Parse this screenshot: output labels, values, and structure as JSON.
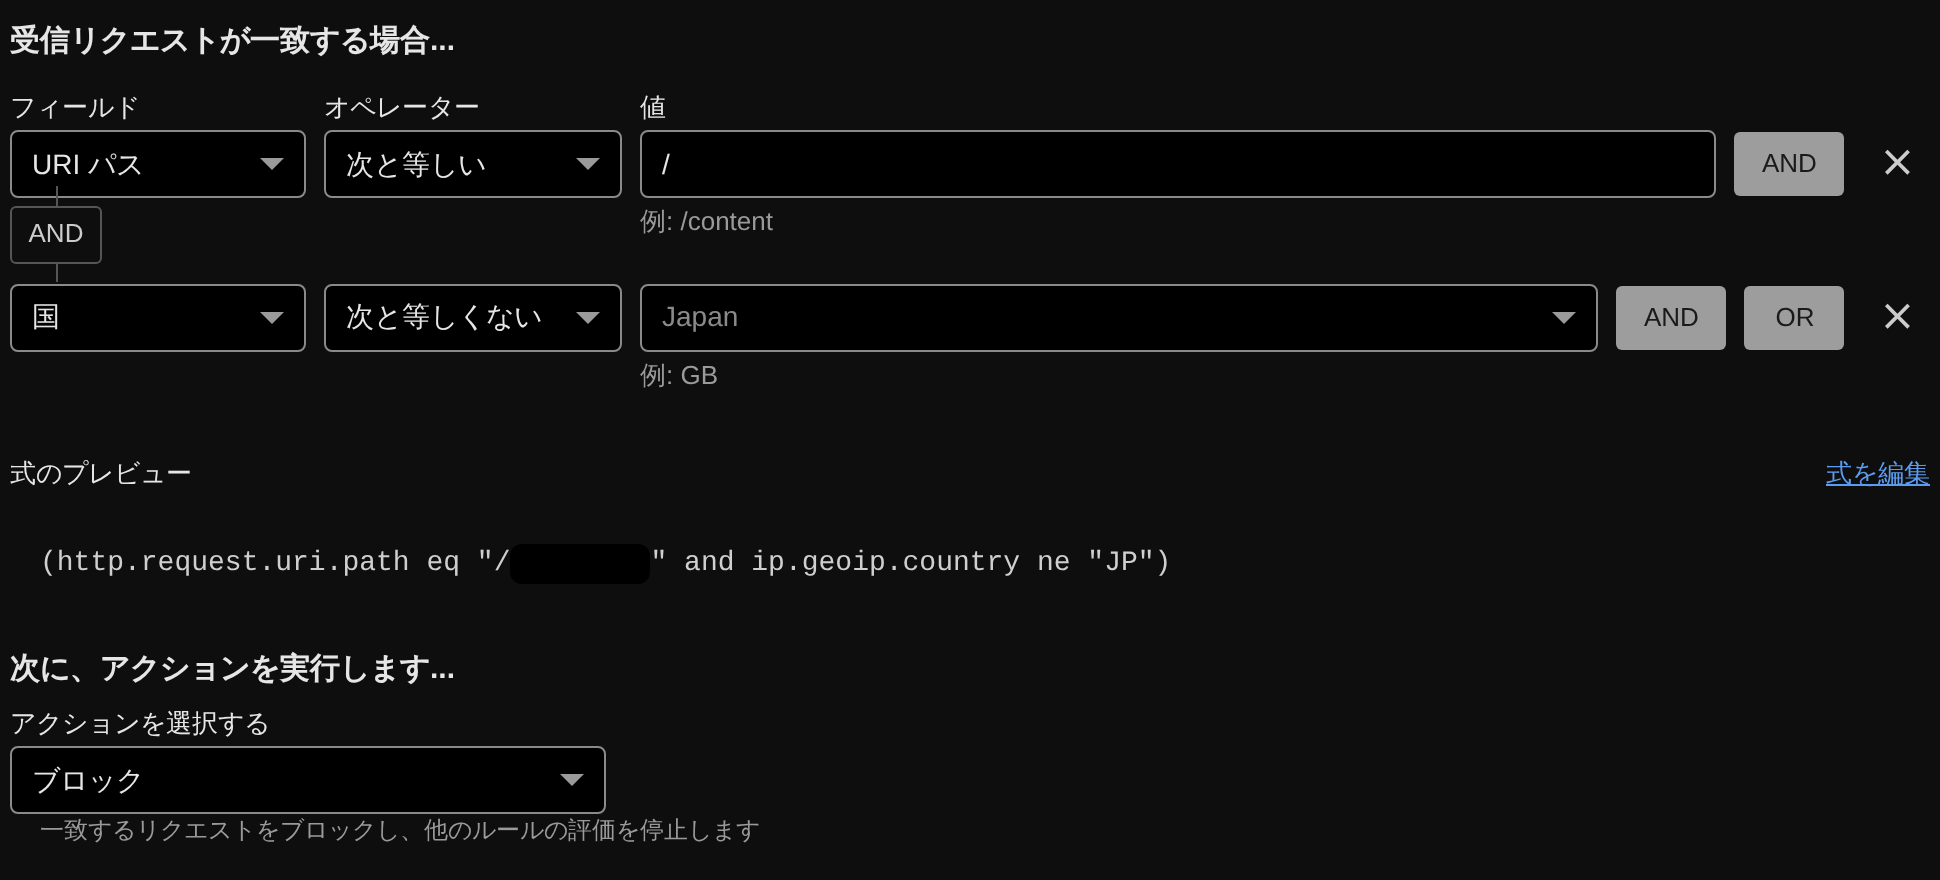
{
  "heading": "受信リクエストが一致する場合...",
  "columns": [
    "フィールド",
    "オペレーター",
    "値"
  ],
  "conditions": [
    {
      "field": "URI パス",
      "operator": "次と等しい",
      "value": {
        "kind": "text",
        "value": "/"
      },
      "hint": "例: /content",
      "buttons": [
        "AND"
      ],
      "remove": "×"
    },
    {
      "field": "国",
      "operator": "次と等しくない",
      "value": {
        "kind": "select",
        "placeholder": "Japan"
      },
      "hint": "例: GB",
      "buttons": [
        "AND",
        "OR"
      ],
      "remove": "×"
    }
  ],
  "connector": "AND",
  "preview": {
    "label": "式のプレビュー",
    "edit_link": "式を編集",
    "expression_start": "(http.request.uri.path eq \"/",
    "expression_end": "\" and ip.geoip.country ne \"JP\")"
  },
  "action": {
    "heading": "次に、アクションを実行します...",
    "label": "アクションを選択する",
    "selected": "ブロック",
    "help": "一致するリクエストをブロックし、他のルールの評価を停止します"
  }
}
